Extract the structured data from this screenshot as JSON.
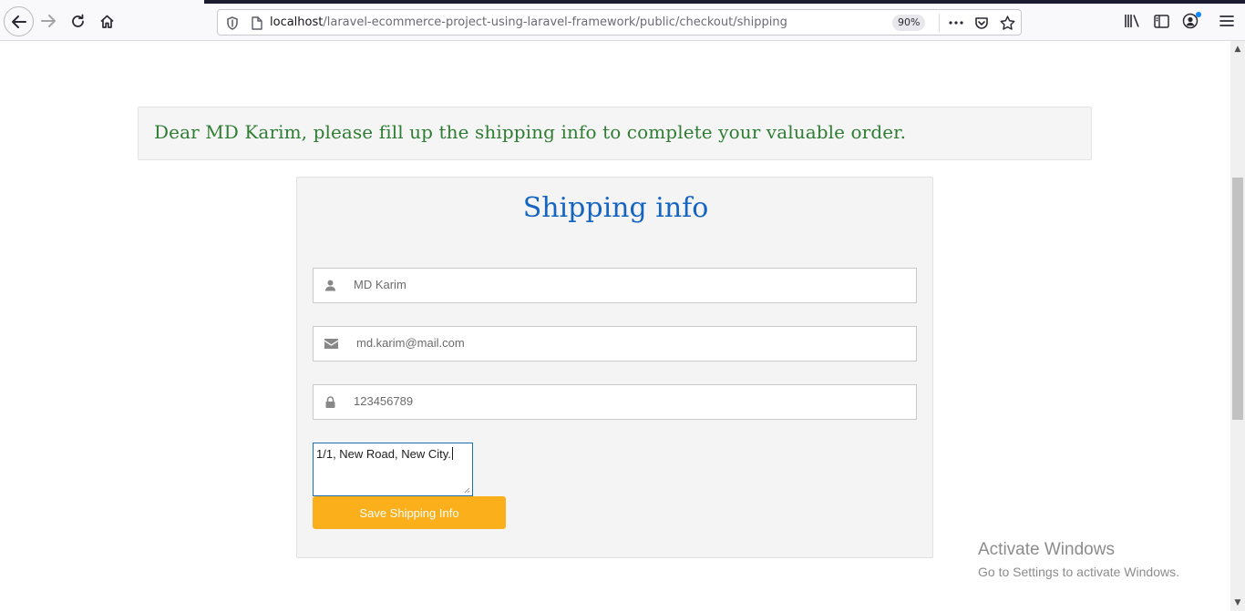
{
  "browser": {
    "url_host": "localhost",
    "url_path": "/laravel-ecommerce-project-using-laravel-framework/public/checkout/shipping",
    "zoom": "90%"
  },
  "notice": {
    "text": "Dear MD Karim, please fill up the shipping info to complete your valuable order."
  },
  "form": {
    "title": "Shipping info",
    "name_value": "MD Karim",
    "email_value": "md.karim@mail.com",
    "phone_value": "123456789",
    "address_value": "1/1, New Road, New City.",
    "submit_label": "Save Shipping Info"
  },
  "watermark": {
    "title": "Activate Windows",
    "subtitle": "Go to Settings to activate Windows."
  },
  "icons": {
    "back": "back-arrow-icon",
    "forward": "forward-arrow-icon",
    "reload": "reload-icon",
    "home": "home-icon",
    "shield": "shield-icon",
    "page": "page-icon",
    "more": "more-icon",
    "pocket": "pocket-icon",
    "star": "star-icon",
    "library": "library-icon",
    "sidebar": "sidebar-icon",
    "account": "account-icon",
    "menu": "hamburger-menu-icon",
    "user": "user-icon",
    "envelope": "envelope-icon",
    "lock": "lock-icon"
  },
  "colors": {
    "notice_text": "#2e7d32",
    "title": "#1565c0",
    "button": "#fbb01b",
    "focus_border": "#1a6fb3"
  }
}
